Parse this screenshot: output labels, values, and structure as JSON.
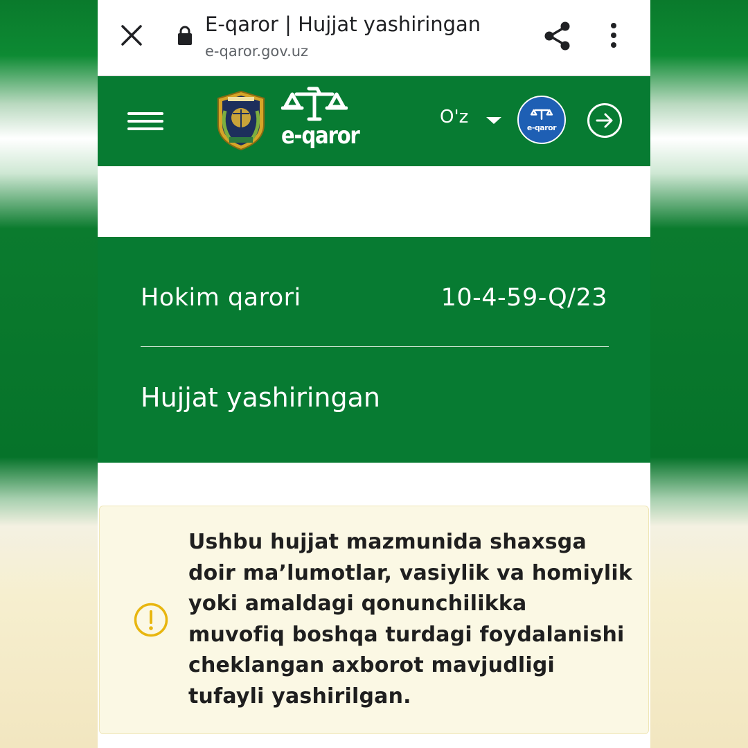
{
  "browser": {
    "title": "E-qaror | Hujjat yashiringan",
    "url": "e-qaror.gov.uz"
  },
  "header": {
    "logo_text": "e-qaror",
    "language": "O'z",
    "badge_text": "e-qaror"
  },
  "document": {
    "type": "Hokim qarori",
    "number": "10-4-59-Q/23",
    "status": "Hujjat yashiringan"
  },
  "notice": {
    "text": "Ushbu hujjat mazmunida shaxsga\ndoir ma’lumotlar, vasiylik va homiylik\nyoki amaldagi qonunchilikka\nmuvofiq boshqa turdagi foydalanishi\ncheklangan axborot mavjudligi\ntufayli yashirilgan."
  },
  "colors": {
    "brand_green": "#077b32",
    "badge_blue": "#1e5fb4",
    "warning_yellow": "#e8b60f",
    "notice_bg": "#fbf8e4"
  },
  "icons": [
    "close-icon",
    "lock-icon",
    "share-icon",
    "more-vert-icon",
    "hamburger-menu-icon",
    "state-emblem-icon",
    "scales-logo-icon",
    "chevron-down-icon",
    "login-arrow-icon",
    "warning-icon"
  ]
}
